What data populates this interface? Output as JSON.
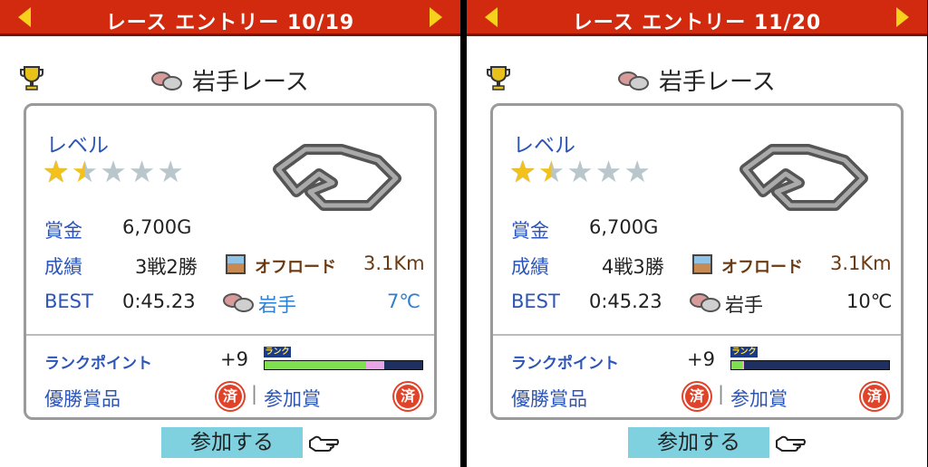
{
  "colors": {
    "header": "#d12a0f",
    "label": "#2c55b8",
    "offroad": "#6b3a12",
    "temp_blue": "#2c7ed0",
    "button": "#7fd1e0"
  },
  "screens": [
    {
      "header_title": "レース エントリー 10/19",
      "race_name": "岩手レース",
      "level_label": "レベル",
      "stars": [
        "full",
        "half",
        "empty",
        "empty",
        "empty"
      ],
      "prize_label": "賞金",
      "prize_value": "6,700G",
      "record_label": "成績",
      "record_value": "3戦2勝",
      "surface": "オフロード",
      "distance": "3.1Km",
      "best_label": "BEST",
      "best_value": "0:45.23",
      "location": "岩手",
      "temperature": "7℃",
      "rank_label": "ランクポイント",
      "rank_value": "+9",
      "rank_tag": "ランク",
      "rank_fill": 0.76,
      "victory_label": "優勝賞品",
      "stamp": "済",
      "divider": "|",
      "participation_label": "参加賞",
      "join_label": "参加する",
      "icons": [
        "trophy-icon",
        "rock-icon",
        "track-icon",
        "offroad-icon",
        "pointing-hand-icon"
      ]
    },
    {
      "header_title": "レース エントリー 11/20",
      "race_name": "岩手レース",
      "level_label": "レベル",
      "stars": [
        "full",
        "half",
        "empty",
        "empty",
        "empty"
      ],
      "prize_label": "賞金",
      "prize_value": "6,700G",
      "record_label": "成績",
      "record_value": "4戦3勝",
      "surface": "オフロード",
      "distance": "3.1Km",
      "best_label": "BEST",
      "best_value": "0:45.23",
      "location": "岩手",
      "temperature": "10℃",
      "rank_label": "ランクポイント",
      "rank_value": "+9",
      "rank_tag": "ランク",
      "rank_fill": 0.08,
      "victory_label": "優勝賞品",
      "stamp": "済",
      "divider": "|",
      "participation_label": "参加賞",
      "join_label": "参加する",
      "icons": [
        "trophy-icon",
        "rock-icon",
        "track-icon",
        "offroad-icon",
        "pointing-hand-icon"
      ]
    }
  ]
}
